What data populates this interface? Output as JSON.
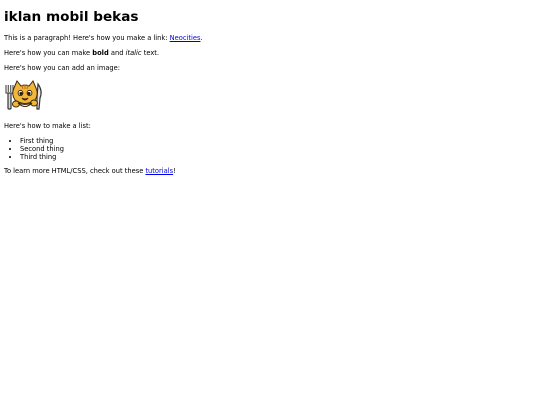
{
  "page": {
    "title": "iklan mobil bekas",
    "p1_prefix": "This is a paragraph! Here's how you make a link: ",
    "p1_link": "Neocities",
    "p1_suffix": ".",
    "p2_prefix": "Here's how you can make ",
    "p2_bold": "bold",
    "p2_mid": " and ",
    "p2_italic": "italic",
    "p2_suffix": " text.",
    "p3": "Here's how you can add an image:",
    "image_icon": "neocities-cat-mascot-icon",
    "p4": "Here's how to make a list:",
    "list_items": [
      "First thing",
      "Second thing",
      "Third thing"
    ],
    "p5_prefix": "To learn more HTML/CSS, check out these ",
    "p5_link": "tutorials",
    "p5_suffix": "!"
  },
  "colors": {
    "link": "#0000ee",
    "text": "#000000",
    "background": "#ffffff"
  }
}
